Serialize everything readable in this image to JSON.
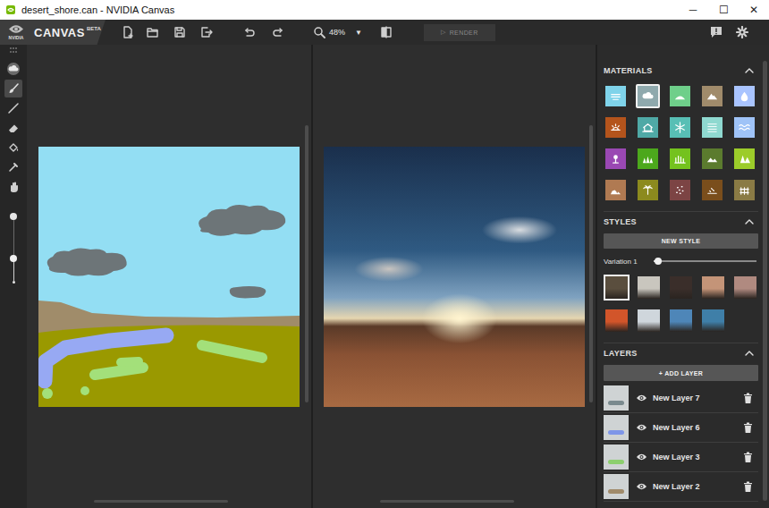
{
  "window": {
    "title": "desert_shore.can - NVIDIA Canvas",
    "controls": [
      "─",
      "☐",
      "✕"
    ]
  },
  "app": {
    "brand": "NVIDIA",
    "name": "CANVAS",
    "badge": "BETA"
  },
  "toolbar": {
    "zoom": "48%",
    "zoom_menu": "▼",
    "render": {
      "icon": "▷",
      "label": "RENDER",
      "disabled": true
    }
  },
  "tools": [
    {
      "kind": "material",
      "selected": false
    },
    {
      "kind": "brush",
      "selected": true
    },
    {
      "kind": "line",
      "selected": false
    },
    {
      "kind": "eraser",
      "selected": false
    },
    {
      "kind": "fill",
      "selected": false
    },
    {
      "kind": "picker",
      "selected": false
    },
    {
      "kind": "pan",
      "selected": false
    }
  ],
  "brush_size": {
    "level": 0.37
  },
  "materials": {
    "title": "MATERIALS",
    "expanded": true,
    "items": [
      {
        "color": "#7fd3ea",
        "selected": false
      },
      {
        "color": "#8fa9ad",
        "selected": true
      },
      {
        "color": "#6fcf8a",
        "selected": false
      },
      {
        "color": "#a08b6b",
        "selected": false
      },
      {
        "color": "#a9c4ff",
        "selected": false
      },
      {
        "color": "#b4541c",
        "selected": false
      },
      {
        "color": "#4fa9a6",
        "selected": false
      },
      {
        "color": "#58bfb5",
        "selected": false
      },
      {
        "color": "#8fd9d0",
        "selected": false
      },
      {
        "color": "#9fc3f7",
        "selected": false
      },
      {
        "color": "#9a48b3",
        "selected": false
      },
      {
        "color": "#4ca81c",
        "selected": false
      },
      {
        "color": "#74c21e",
        "selected": false
      },
      {
        "color": "#5b7b2e",
        "selected": false
      },
      {
        "color": "#9ccc2a",
        "selected": false
      },
      {
        "color": "#b07a52",
        "selected": false
      },
      {
        "color": "#8c8a1e",
        "selected": false
      },
      {
        "color": "#7c4444",
        "selected": false
      },
      {
        "color": "#7a4e1c",
        "selected": false
      },
      {
        "color": "#8a7b45",
        "selected": false
      }
    ]
  },
  "styles": {
    "title": "STYLES",
    "expanded": true,
    "new_style": "NEW STYLE",
    "variation": {
      "label": "Variation 1",
      "level": 0.05
    },
    "items": [
      {
        "color": "#5a4e3e",
        "selected": true
      },
      {
        "color": "#c9c6be",
        "selected": false
      },
      {
        "color": "#3a2e2a",
        "selected": false
      },
      {
        "color": "#c49478",
        "selected": false
      },
      {
        "color": "#b08a80",
        "selected": false
      },
      {
        "color": "#d2552a",
        "selected": false
      },
      {
        "color": "#cfd6dc",
        "selected": false
      },
      {
        "color": "#4e86b8",
        "selected": false
      },
      {
        "color": "#3f7fa8",
        "selected": false
      }
    ]
  },
  "layers": {
    "title": "LAYERS",
    "expanded": true,
    "add_layer": "+ ADD LAYER",
    "items": [
      {
        "name": "New Layer 7",
        "visible": true,
        "color": "#7a8a8e"
      },
      {
        "name": "New Layer 6",
        "visible": true,
        "color": "#7e96e8"
      },
      {
        "name": "New Layer 3",
        "visible": true,
        "color": "#8ccf6e"
      },
      {
        "name": "New Layer 2",
        "visible": true,
        "color": "#a08b6b"
      }
    ]
  }
}
